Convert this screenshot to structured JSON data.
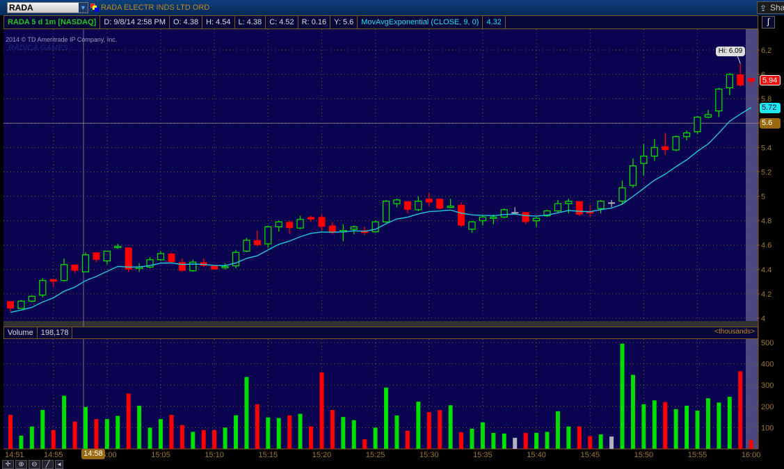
{
  "header": {
    "symbol": "RADA",
    "description": "RADA ELECTR INDS LTD ORD",
    "share_label": "Sha"
  },
  "info": {
    "title": "RADA 5 d 1m [NASDAQ]",
    "date": "D: 9/8/14 2:58 PM",
    "open": "O: 4.38",
    "high": "H: 4.54",
    "low": "L: 4.38",
    "close": "C: 4.52",
    "range": "R: 0.16",
    "y": "Y: 5.6",
    "study": "MovAvgExponential (CLOSE, 9, 0)",
    "study_value": "4.32"
  },
  "copyright": "2014 © TD Ameritrade IP Company, Inc.",
  "watermark": "RADICA GAMES",
  "hi_label": "Hi: 6.09",
  "badges": {
    "last": "5.94",
    "ema": "5.72",
    "cursor": "5.6",
    "cursor_time": "14:58"
  },
  "volume": {
    "label": "Volume",
    "value": "198,178",
    "units": "<thousands>"
  },
  "colors": {
    "up": "#00dd00",
    "down": "#ff0000",
    "flat": "#b0b0c0",
    "ema": "#20c8e0",
    "bg": "#0a0450",
    "grid": "#8a5a1a"
  },
  "chart_data": {
    "type": "candlestick",
    "x": [
      "14:51",
      "14:52",
      "14:53",
      "14:54",
      "14:55",
      "14:56",
      "14:57",
      "14:58",
      "14:59",
      "15:00",
      "15:01",
      "15:02",
      "15:03",
      "15:04",
      "15:05",
      "15:06",
      "15:07",
      "15:08",
      "15:09",
      "15:10",
      "15:11",
      "15:12",
      "15:13",
      "15:14",
      "15:15",
      "15:16",
      "15:17",
      "15:18",
      "15:19",
      "15:20",
      "15:21",
      "15:22",
      "15:23",
      "15:24",
      "15:25",
      "15:26",
      "15:27",
      "15:28",
      "15:29",
      "15:30",
      "15:31",
      "15:32",
      "15:33",
      "15:34",
      "15:35",
      "15:36",
      "15:37",
      "15:38",
      "15:39",
      "15:40",
      "15:41",
      "15:42",
      "15:43",
      "15:44",
      "15:45",
      "15:46",
      "15:47",
      "15:48",
      "15:49",
      "15:50",
      "15:51",
      "15:52",
      "15:53",
      "15:54",
      "15:55",
      "15:56",
      "15:57",
      "15:58",
      "15:59",
      "16:00"
    ],
    "open": [
      4.14,
      4.08,
      4.14,
      4.19,
      4.32,
      4.31,
      4.44,
      4.38,
      4.54,
      4.47,
      4.58,
      4.58,
      4.41,
      4.42,
      4.48,
      4.53,
      4.46,
      4.39,
      4.46,
      4.43,
      4.42,
      4.43,
      4.55,
      4.64,
      4.61,
      4.75,
      4.79,
      4.74,
      4.83,
      4.83,
      4.76,
      4.71,
      4.73,
      4.72,
      4.71,
      4.79,
      4.94,
      4.96,
      4.89,
      4.98,
      4.98,
      4.91,
      4.93,
      4.73,
      4.8,
      4.82,
      4.83,
      4.87,
      4.87,
      4.8,
      4.84,
      4.88,
      4.94,
      4.96,
      4.88,
      4.9,
      4.95,
      4.96,
      5.09,
      5.27,
      5.33,
      5.41,
      5.38,
      5.49,
      5.53,
      5.65,
      5.7,
      5.89,
      6.0,
      5.97
    ],
    "high": [
      4.14,
      4.15,
      4.19,
      4.33,
      4.32,
      4.49,
      4.44,
      4.54,
      4.54,
      4.55,
      4.61,
      4.58,
      4.45,
      4.5,
      4.55,
      4.54,
      4.49,
      4.48,
      4.49,
      4.43,
      4.45,
      4.56,
      4.66,
      4.72,
      4.76,
      4.8,
      4.8,
      4.84,
      4.84,
      4.85,
      4.79,
      4.77,
      4.76,
      4.75,
      4.8,
      4.97,
      4.98,
      4.96,
      5.0,
      5.03,
      4.98,
      4.98,
      4.95,
      4.8,
      4.84,
      4.85,
      4.9,
      4.91,
      4.87,
      4.83,
      4.89,
      4.97,
      4.98,
      4.96,
      4.93,
      4.97,
      4.97,
      5.13,
      5.31,
      5.43,
      5.47,
      5.52,
      5.5,
      5.54,
      5.66,
      5.71,
      5.89,
      6.01,
      6.09,
      5.97
    ],
    "low": [
      4.06,
      4.08,
      4.13,
      4.17,
      4.26,
      4.3,
      4.37,
      4.38,
      4.46,
      4.44,
      4.57,
      4.38,
      4.38,
      4.41,
      4.47,
      4.45,
      4.38,
      4.38,
      4.42,
      4.4,
      4.4,
      4.41,
      4.54,
      4.59,
      4.58,
      4.71,
      4.69,
      4.73,
      4.79,
      4.72,
      4.69,
      4.63,
      4.69,
      4.68,
      4.7,
      4.78,
      4.91,
      4.86,
      4.88,
      4.92,
      4.89,
      4.91,
      4.75,
      4.7,
      4.76,
      4.77,
      4.82,
      4.87,
      4.77,
      4.75,
      4.83,
      4.87,
      4.86,
      4.84,
      4.83,
      4.86,
      4.91,
      4.93,
      5.07,
      5.17,
      5.29,
      5.34,
      5.37,
      5.46,
      5.51,
      5.64,
      5.65,
      5.83,
      5.9,
      5.9
    ],
    "close": [
      4.08,
      4.14,
      4.18,
      4.31,
      4.3,
      4.44,
      4.39,
      4.52,
      4.48,
      4.55,
      4.59,
      4.4,
      4.42,
      4.48,
      4.53,
      4.46,
      4.39,
      4.46,
      4.43,
      4.4,
      4.425,
      4.54,
      4.64,
      4.6,
      4.75,
      4.79,
      4.74,
      4.81,
      4.81,
      4.75,
      4.7,
      4.72,
      4.75,
      4.7,
      4.79,
      4.96,
      4.97,
      4.89,
      4.96,
      4.95,
      4.9,
      4.92,
      4.76,
      4.79,
      4.83,
      4.83,
      4.89,
      4.87,
      4.79,
      4.82,
      4.88,
      4.94,
      4.96,
      4.85,
      4.86,
      4.96,
      4.95,
      5.07,
      5.25,
      5.33,
      5.4,
      5.38,
      5.49,
      5.52,
      5.65,
      5.67,
      5.88,
      6.0,
      5.91,
      5.94
    ],
    "volume": [
      160,
      62,
      105,
      183,
      88,
      250,
      128,
      197,
      140,
      140,
      155,
      260,
      203,
      100,
      140,
      160,
      112,
      80,
      88,
      88,
      100,
      158,
      338,
      210,
      148,
      145,
      157,
      165,
      105,
      360,
      183,
      150,
      135,
      45,
      100,
      288,
      157,
      85,
      222,
      173,
      182,
      205,
      78,
      95,
      125,
      75,
      72,
      52,
      75,
      75,
      80,
      177,
      105,
      105,
      60,
      68,
      58,
      495,
      348,
      210,
      228,
      220,
      187,
      203,
      180,
      238,
      218,
      245,
      365,
      42
    ],
    "ema_period": 9,
    "price_ticks": [
      "6.2",
      "6",
      "5.8",
      "5.6",
      "5.4",
      "5.2",
      "5",
      "4.8",
      "4.6",
      "4.4",
      "4.2",
      "4"
    ],
    "ylim": [
      4,
      6.2
    ],
    "volume_ticks": [
      "500",
      "400",
      "300",
      "200",
      "100"
    ],
    "volume_ylim": [
      0,
      500
    ],
    "time_ticks": [
      "14:51",
      "14:55",
      "15:00",
      "15:05",
      "15:10",
      "15:15",
      "15:20",
      "15:25",
      "15:30",
      "15:35",
      "15:40",
      "15:45",
      "15:50",
      "15:55",
      "16:00"
    ]
  }
}
